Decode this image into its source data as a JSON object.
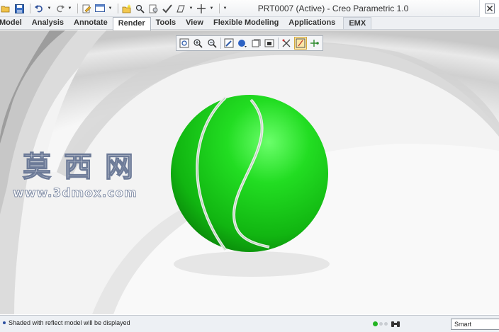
{
  "window": {
    "title": "PRT0007 (Active) - Creo Parametric 1.0"
  },
  "quick_access": {
    "items": [
      "open-icon",
      "save-icon",
      "undo-icon",
      "redo-icon",
      "regenerate-icon",
      "windows-icon",
      "new-folder-icon",
      "find-icon",
      "settings-icon",
      "check-icon",
      "sketch-icon",
      "datum-icon",
      "customize-icon"
    ]
  },
  "ribbon": {
    "tabs": [
      {
        "label": "Model"
      },
      {
        "label": "Analysis"
      },
      {
        "label": "Annotate"
      },
      {
        "label": "Render",
        "active": true
      },
      {
        "label": "Tools"
      },
      {
        "label": "View"
      },
      {
        "label": "Flexible Modeling"
      },
      {
        "label": "Applications"
      },
      {
        "label": "EMX"
      }
    ]
  },
  "view_toolbar": {
    "buttons": [
      "refit-icon",
      "zoom-in-icon",
      "zoom-out-icon",
      "repaint-icon",
      "display-style-icon",
      "saved-orientations-icon",
      "view-manager-icon",
      "perspective-icon",
      "datum-display-icon",
      "annotation-display-icon",
      "spin-center-icon"
    ],
    "active_index": 9
  },
  "scene": {
    "ball_color": "#1fd41f",
    "seam_color": "#e8ece8",
    "background_color": "#f5f5f5"
  },
  "watermark": {
    "cn": "莫西网",
    "url": "www.3dmox.com"
  },
  "status": {
    "message": "Shaded with reflect model will be displayed",
    "filter_value": "Smart",
    "lights": [
      "#22b422",
      "#c9cdd2",
      "#c9cdd2"
    ]
  }
}
